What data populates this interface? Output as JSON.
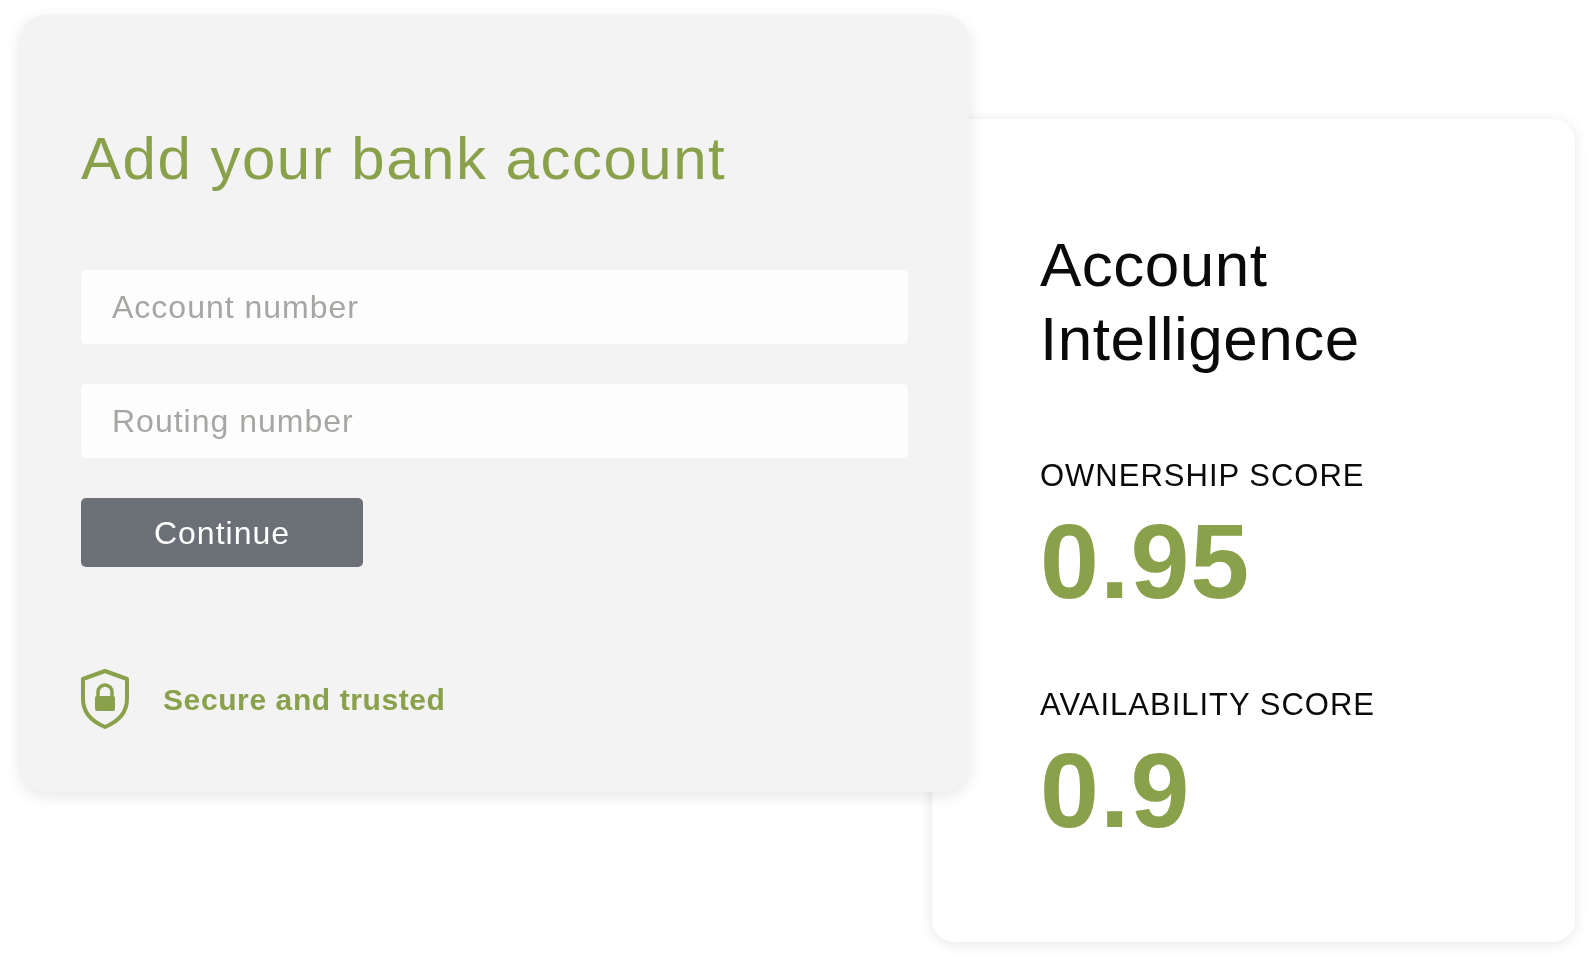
{
  "bank_account_form": {
    "title": "Add your bank account",
    "fields": [
      {
        "placeholder": "Account number"
      },
      {
        "placeholder": "Routing number"
      }
    ],
    "button": "Continue",
    "trust_badge": "Secure and trusted"
  },
  "account_intelligence": {
    "title": "Account Intelligence",
    "scores": [
      {
        "label": "OWNERSHIP SCORE",
        "value": "0.95"
      },
      {
        "label": "AVAILABILITY SCORE",
        "value": "0.9"
      }
    ]
  }
}
